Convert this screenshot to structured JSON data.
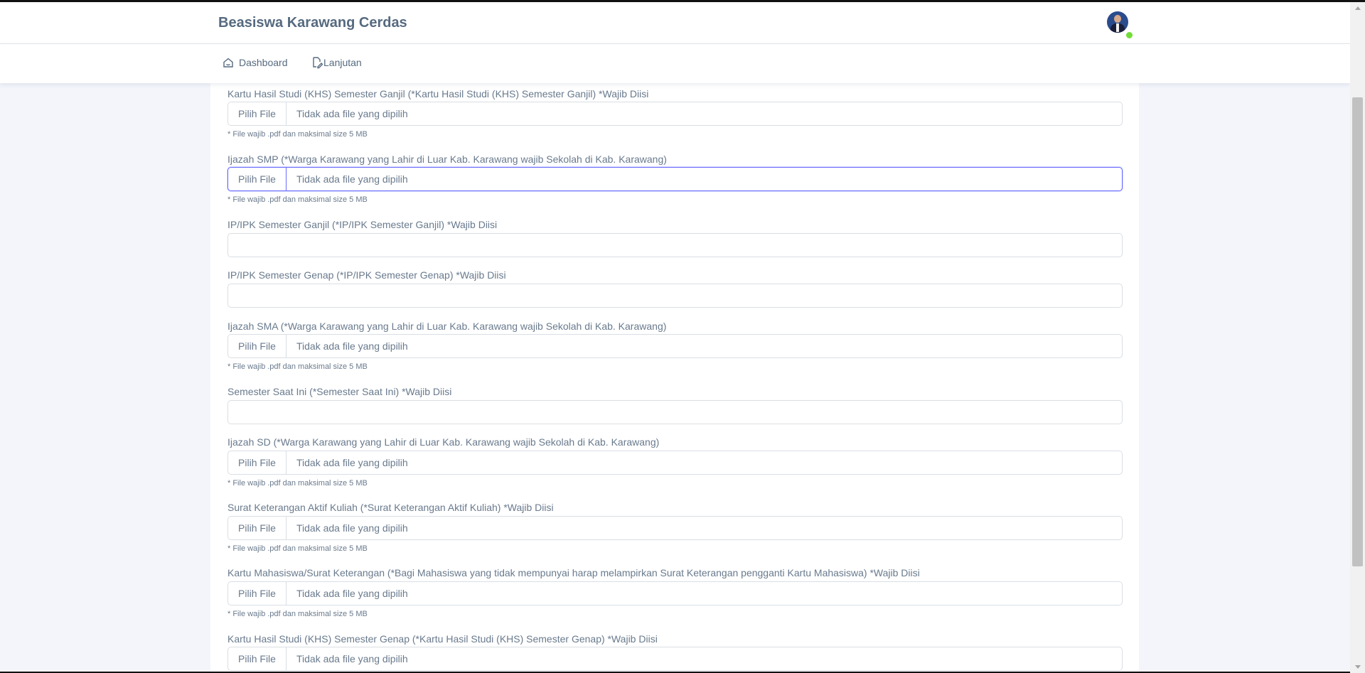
{
  "app": {
    "title": "Beasiswa Karawang Cerdas"
  },
  "nav": {
    "items": [
      {
        "label": "Dashboard",
        "icon": "home-icon"
      },
      {
        "label": "Lanjutan",
        "icon": "file-edit-icon"
      }
    ]
  },
  "common": {
    "file_button": "Pilih File",
    "no_file": "Tidak ada file yang dipilih",
    "file_hint": "* File wajib .pdf dan maksimal size 5 MB"
  },
  "fields": [
    {
      "label": "Kartu Hasil Studi (KHS) Semester Ganjil (*Kartu Hasil Studi (KHS) Semester Ganjil) *Wajib Diisi",
      "type": "file"
    },
    {
      "label": "Ijazah SMP (*Warga Karawang yang Lahir di Luar Kab. Karawang wajib Sekolah di Kab. Karawang)",
      "type": "file",
      "focused": true
    },
    {
      "label": "IP/IPK Semester Ganjil (*IP/IPK Semester Ganjil) *Wajib Diisi",
      "type": "text",
      "value": ""
    },
    {
      "label": "IP/IPK Semester Genap (*IP/IPK Semester Genap) *Wajib Diisi",
      "type": "text",
      "value": ""
    },
    {
      "label": "Ijazah SMA (*Warga Karawang yang Lahir di Luar Kab. Karawang wajib Sekolah di Kab. Karawang)",
      "type": "file"
    },
    {
      "label": "Semester Saat Ini (*Semester Saat Ini) *Wajib Diisi",
      "type": "text",
      "value": ""
    },
    {
      "label": "Ijazah SD (*Warga Karawang yang Lahir di Luar Kab. Karawang wajib Sekolah di Kab. Karawang)",
      "type": "file"
    },
    {
      "label": "Surat Keterangan Aktif Kuliah (*Surat Keterangan Aktif Kuliah) *Wajib Diisi",
      "type": "file"
    },
    {
      "label": "Kartu Mahasiswa/Surat Keterangan (*Bagi Mahasiswa yang tidak mempunyai harap melampirkan Surat Keterangan pengganti Kartu Mahasiswa) *Wajib Diisi",
      "type": "file"
    },
    {
      "label": "Kartu Hasil Studi (KHS) Semester Genap (*Kartu Hasil Studi (KHS) Semester Genap) *Wajib Diisi",
      "type": "file"
    }
  ],
  "colors": {
    "accent": "#696cff",
    "online_status": "#71dd37"
  }
}
